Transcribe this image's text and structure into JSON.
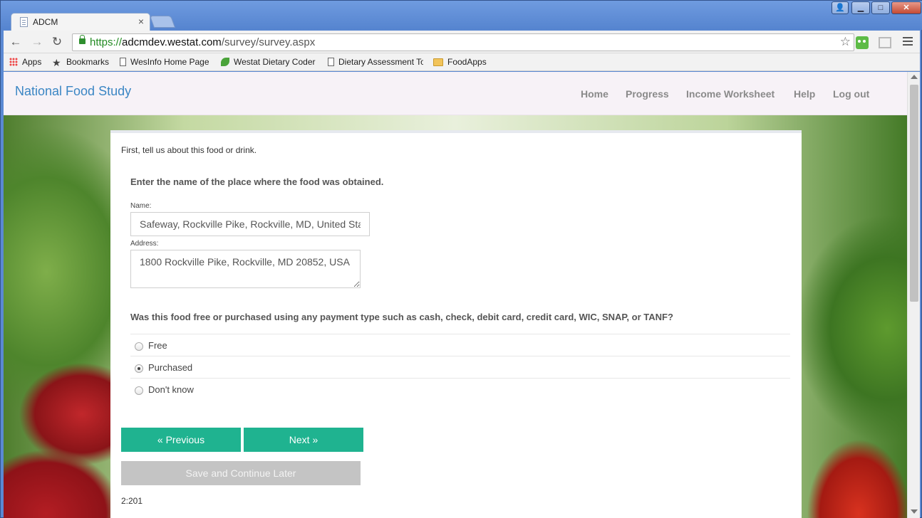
{
  "browser": {
    "tab_title": "ADCM",
    "tab_close": "×",
    "window_controls": {
      "user": "👤",
      "minimize": "▁",
      "maximize": "□",
      "close": "✕"
    },
    "url": {
      "scheme": "https://",
      "host": "adcmdev.westat.com",
      "path": "/survey/survey.aspx"
    },
    "bookmarks": [
      {
        "label": "Apps",
        "icon": "apps-grid-icon"
      },
      {
        "label": "Bookmarks",
        "icon": "star-icon"
      },
      {
        "label": "WesInfo Home Page",
        "icon": "page-icon"
      },
      {
        "label": "Westat Dietary Coder",
        "icon": "leaf-icon"
      },
      {
        "label": "Dietary Assessment To",
        "icon": "page-icon"
      },
      {
        "label": "FoodApps",
        "icon": "folder-icon"
      }
    ]
  },
  "site": {
    "brand": "National Food Study",
    "nav": [
      "Home",
      "Progress",
      "Income Worksheet",
      "Help",
      "Log out"
    ]
  },
  "form": {
    "intro": "First, tell us about this food or drink.",
    "question1": "Enter the name of the place where the food was obtained.",
    "name_label": "Name:",
    "name_value": "Safeway, Rockville Pike, Rockville, MD, United States",
    "address_label": "Address:",
    "address_value": "1800 Rockville Pike, Rockville, MD 20852, USA",
    "question2": "Was this food free or purchased using any payment type such as cash, check, debit card, credit card, WIC, SNAP, or TANF?",
    "options": [
      {
        "label": "Free",
        "selected": false
      },
      {
        "label": "Purchased",
        "selected": true
      },
      {
        "label": "Don't know",
        "selected": false
      }
    ],
    "previous_label": "« Previous",
    "next_label": "Next »",
    "save_label": "Save and Continue Later",
    "screen_code": "2:201"
  },
  "colors": {
    "brand": "#3b86c4",
    "primary_button": "#1fb390",
    "disabled_button": "#c4c4c4"
  }
}
